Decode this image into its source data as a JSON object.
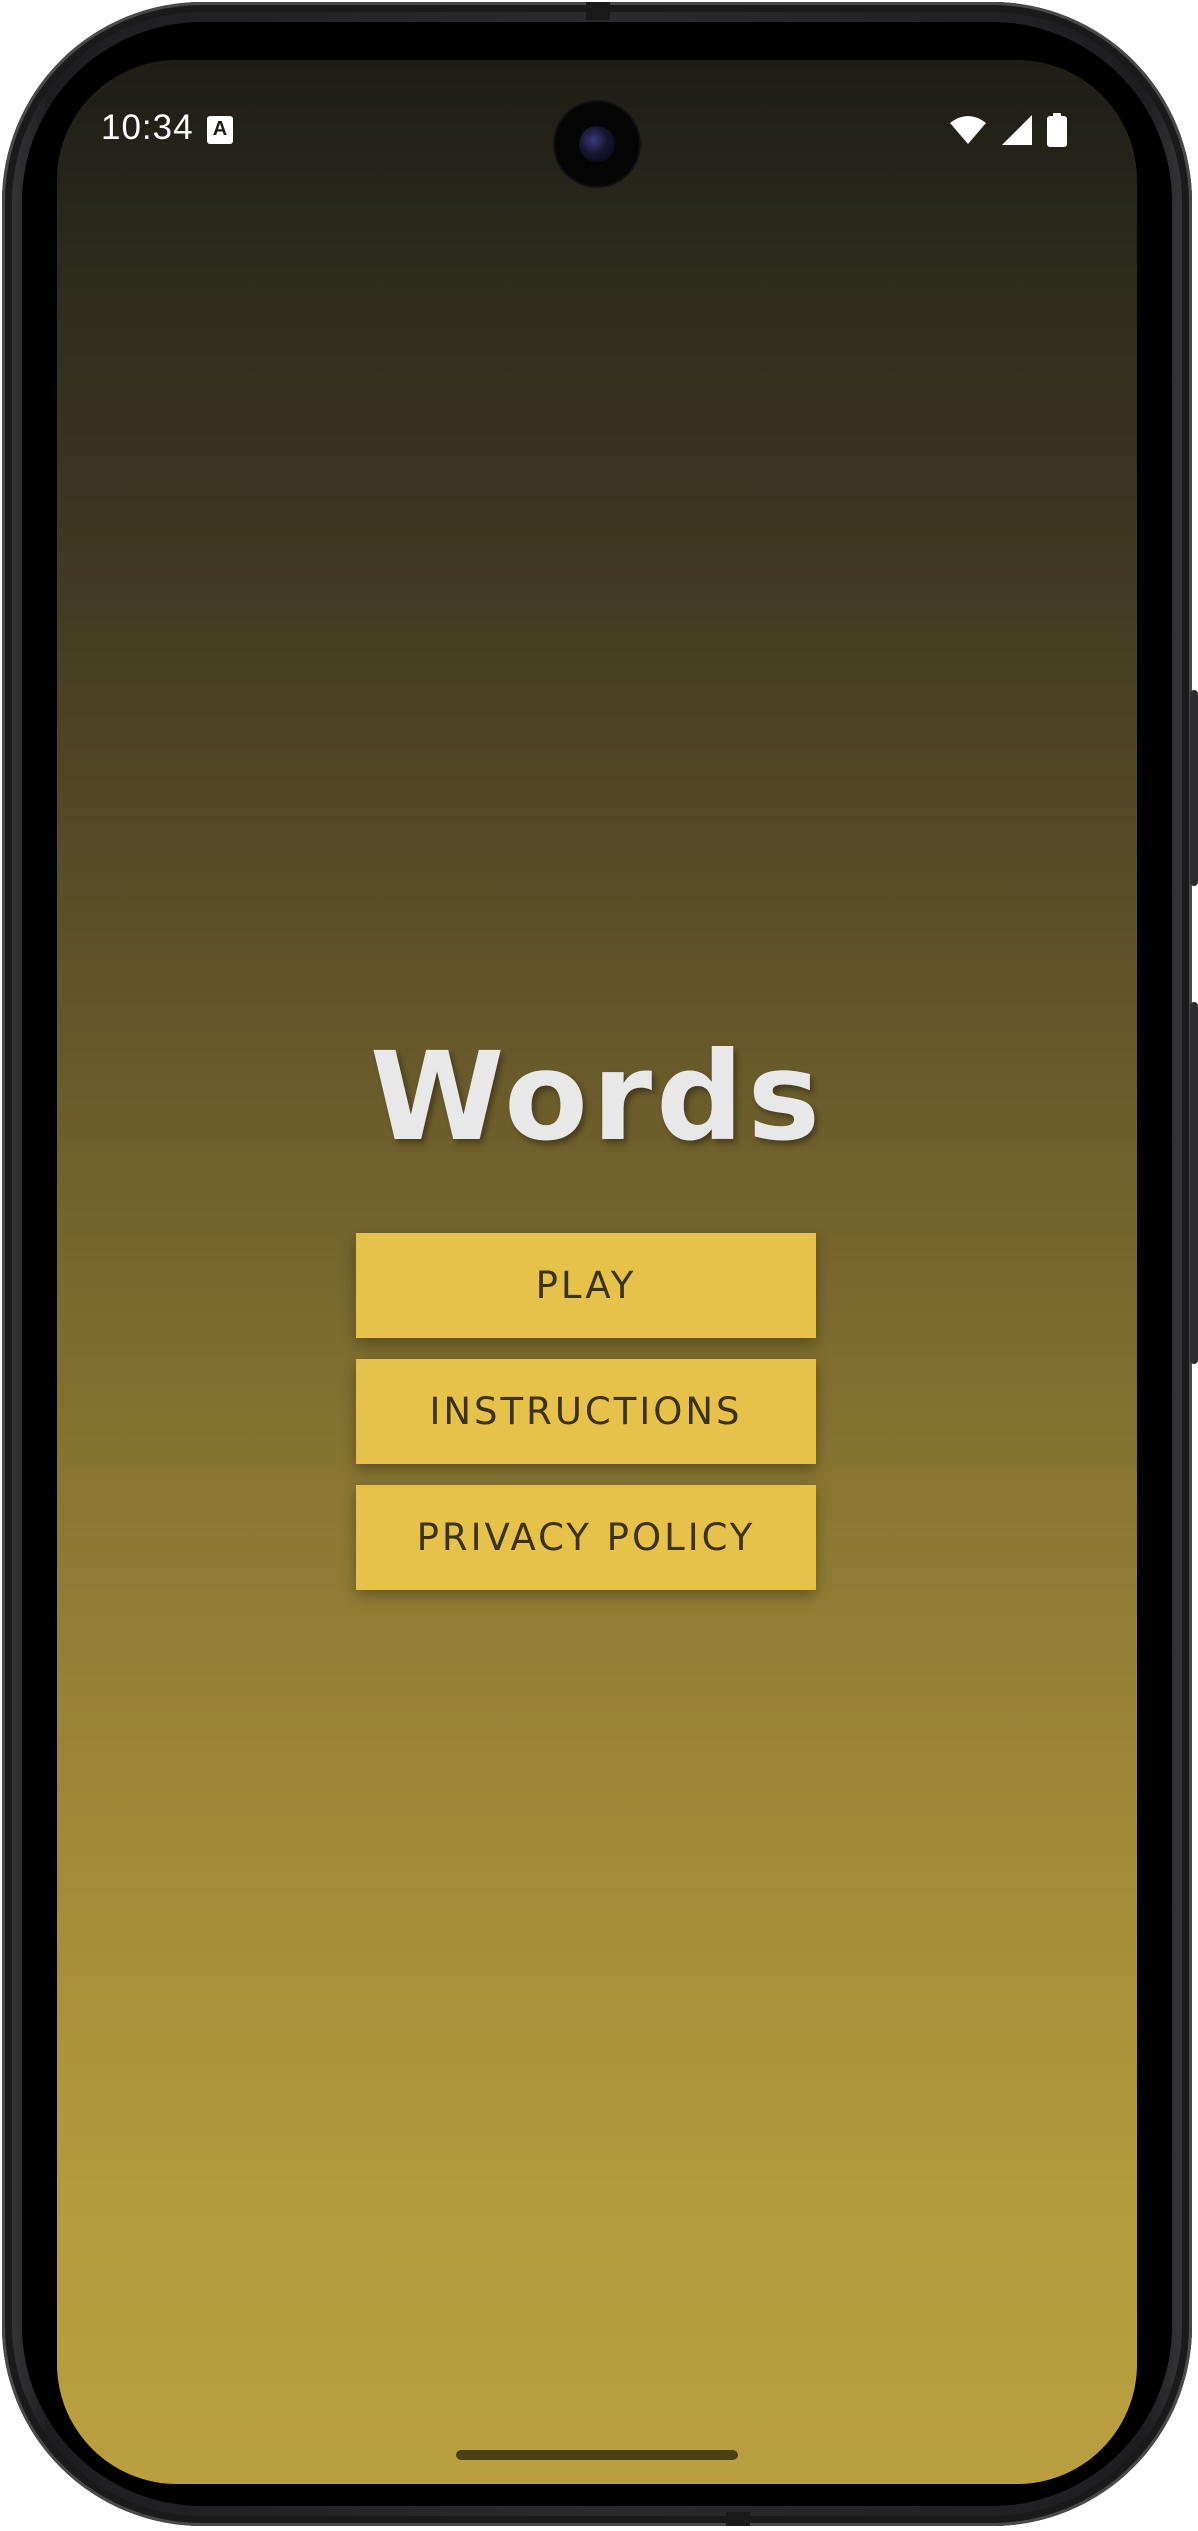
{
  "status_bar": {
    "time": "10:34",
    "notification_icon_letter": "A",
    "icons": [
      "wifi-icon",
      "cellular-signal-icon",
      "battery-icon"
    ]
  },
  "app": {
    "title": "Words"
  },
  "menu": {
    "play_label": "PLAY",
    "instructions_label": "INSTRUCTIONS",
    "privacy_policy_label": "PRIVACY POLICY"
  },
  "colors": {
    "button_bg": "#e6c24a",
    "button_text": "#3a3317",
    "title_text": "#e8e8e8",
    "background_top": "#1e1d17",
    "background_bottom": "#b99f3f"
  }
}
